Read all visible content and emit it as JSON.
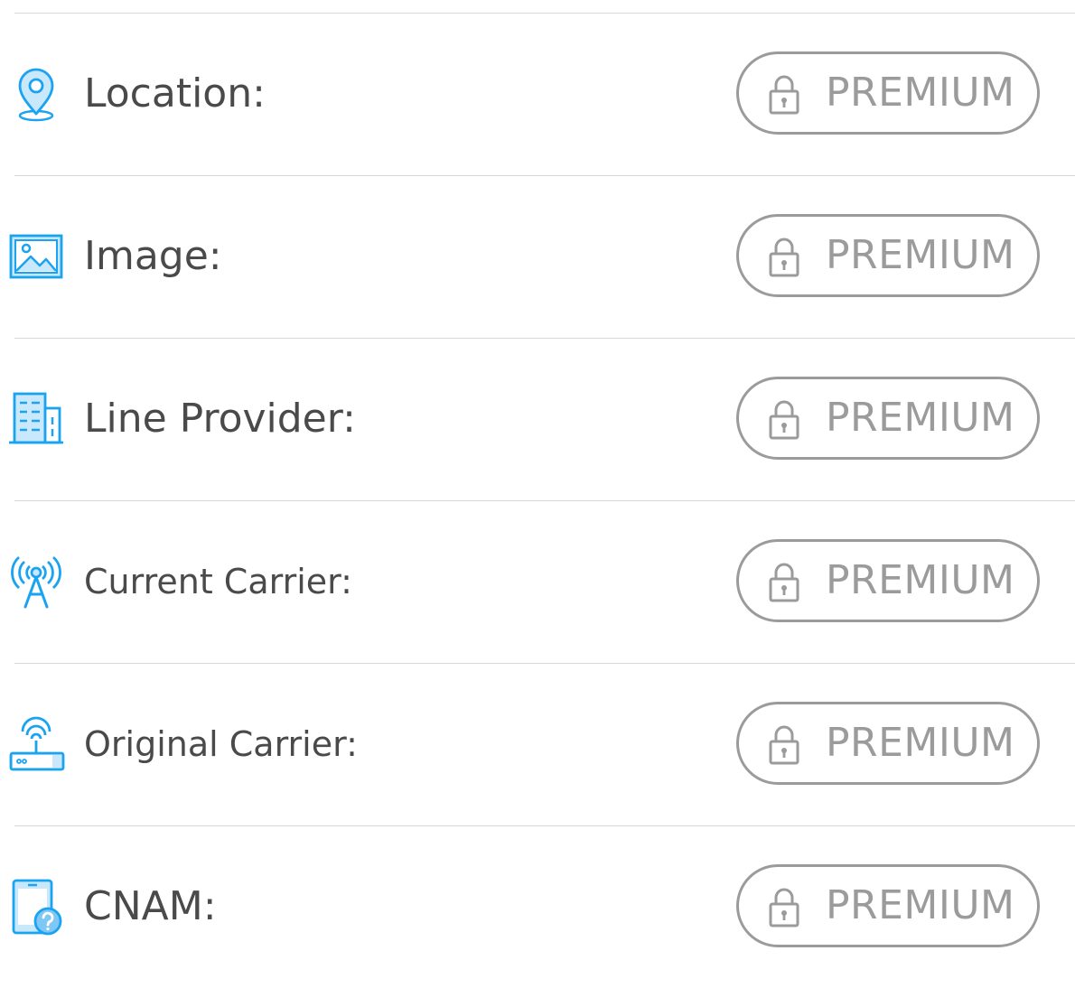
{
  "rows": [
    {
      "label": "Location:",
      "icon": "map-pin-icon",
      "action_label": "PREMIUM"
    },
    {
      "label": "Image:",
      "icon": "image-icon",
      "action_label": "PREMIUM"
    },
    {
      "label": "Line Provider:",
      "icon": "building-icon",
      "action_label": "PREMIUM"
    },
    {
      "label": "Current Carrier:",
      "icon": "cell-tower-icon",
      "action_label": "PREMIUM"
    },
    {
      "label": "Original Carrier:",
      "icon": "router-icon",
      "action_label": "PREMIUM"
    },
    {
      "label": "CNAM:",
      "icon": "phone-unknown-icon",
      "action_label": "PREMIUM"
    }
  ],
  "colors": {
    "icon_accent": "#1aa3f0",
    "icon_fill": "#c9e8fb",
    "label_text": "#4a4a4a",
    "premium_gray": "#9b9b9b",
    "divider": "#d8d8d8"
  }
}
